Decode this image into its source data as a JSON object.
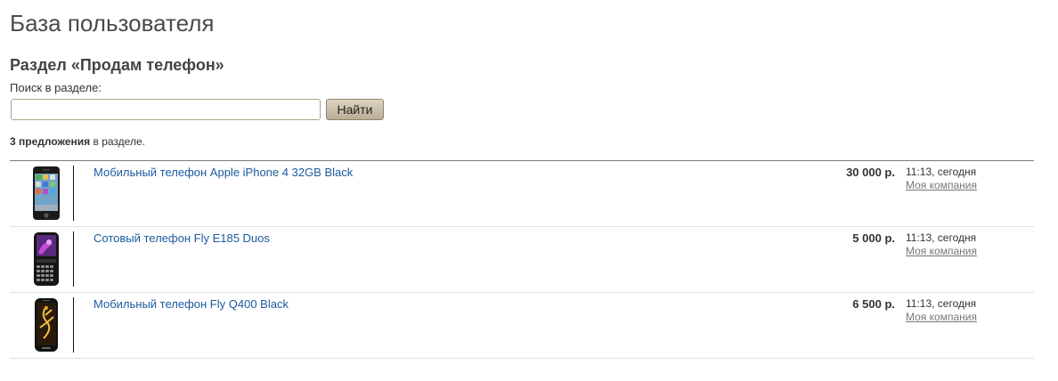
{
  "page": {
    "title": "База пользователя",
    "section_title": "Раздел «Продам телефон»"
  },
  "search": {
    "label": "Поиск в разделе:",
    "value": "",
    "placeholder": "",
    "button_label": "Найти"
  },
  "results": {
    "count_bold": "3 предложения",
    "count_rest": " в разделе."
  },
  "listings": [
    {
      "title": "Мобильный телефон Apple iPhone 4 32GB Black",
      "price": "30 000 р.",
      "time": "11:13, сегодня",
      "company": "Моя компания",
      "thumb_icon": "iphone-thumbnail-icon"
    },
    {
      "title": "Сотовый телефон Fly E185 Duos",
      "price": "5 000 р.",
      "time": "11:13, сегодня",
      "company": "Моя компания",
      "thumb_icon": "fly-e185-thumbnail-icon"
    },
    {
      "title": "Мобильный телефон Fly Q400 Black",
      "price": "6 500 р.",
      "time": "11:13, сегодня",
      "company": "Моя компания",
      "thumb_icon": "fly-q400-thumbnail-icon"
    }
  ],
  "colors": {
    "link": "#1a5a9e",
    "button_bg": "#c9bfa9",
    "input_border": "#a9a58a"
  }
}
